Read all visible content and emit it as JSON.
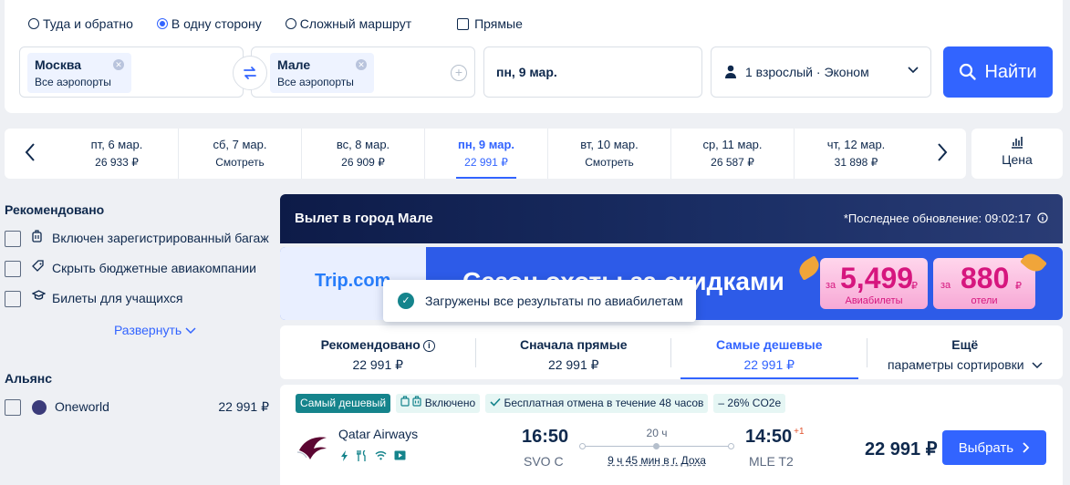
{
  "trip_types": {
    "round_trip": "Туда и обратно",
    "one_way": "В одну сторону",
    "multi_city": "Сложный маршрут",
    "direct": "Прямые"
  },
  "search": {
    "origin_city": "Москва",
    "origin_sub": "Все аэропорты",
    "dest_city": "Мале",
    "dest_sub": "Все аэропорты",
    "date": "пн, 9 мар.",
    "passengers": "1 взрослый · Эконом",
    "button": "Найти"
  },
  "date_bar": {
    "cells": [
      {
        "date": "пт, 6 мар.",
        "price": "26 933 ₽"
      },
      {
        "date": "сб, 7 мар.",
        "price": "Смотреть"
      },
      {
        "date": "вс, 8 мар.",
        "price": "26 909 ₽"
      },
      {
        "date": "пн, 9 мар.",
        "price": "22 991 ₽"
      },
      {
        "date": "вт, 10 мар.",
        "price": "Смотреть"
      },
      {
        "date": "ср, 11 мар.",
        "price": "26 587 ₽"
      },
      {
        "date": "чт, 12 мар.",
        "price": "31 898 ₽"
      }
    ],
    "price_label": "Цена"
  },
  "filters": {
    "recommended_title": "Рекомендовано",
    "items": [
      "Включен зарегистрированный багаж",
      "Скрыть бюджетные авиакомпании",
      "Билеты для учащихся"
    ],
    "expand": "Развернуть",
    "alliance_title": "Альянс",
    "alliance_name": "Oneworld",
    "alliance_price": "22 991 ₽"
  },
  "banner": {
    "title": "Вылет в город Мале",
    "updated": "*Последнее обновление: 09:02:17"
  },
  "ad": {
    "logo": "Trip.com",
    "title": "Сезон охоты за скидками",
    "flights_prefix": "за",
    "flights_price": "5,499",
    "flights_currency": "₽",
    "flights_caption": "Авиабилеты",
    "hotels_prefix": "за",
    "hotels_price": "880",
    "hotels_currency": "₽",
    "hotels_caption": "отели"
  },
  "toast": {
    "text": "Загружены все результаты по авиабилетам"
  },
  "sort": [
    {
      "label": "Рекомендовано",
      "value": "22 991 ₽"
    },
    {
      "label": "Сначала прямые",
      "value": "22 991 ₽"
    },
    {
      "label": "Самые дешевые",
      "value": "22 991 ₽"
    },
    {
      "label": "Ещё",
      "value": "параметры сортировки"
    }
  ],
  "flight": {
    "tag_cheapest": "Самый дешевый",
    "tag_included": "Включено",
    "tag_cancel": "Бесплатная отмена в течение 48 часов",
    "tag_co2": "– 26% CO2e",
    "airline": "Qatar Airways",
    "dep_time": "16:50",
    "dep_airport": "SVO C",
    "duration": "20 ч",
    "stopover": "9 ч 45 мин в г. Доха",
    "arr_time": "14:50",
    "arr_days": "+1",
    "arr_airport": "MLE T2",
    "price": "22 991 ₽",
    "select": "Выбрать"
  },
  "colors": {
    "accent": "#3264ff",
    "teal": "#15848c",
    "promo_pink": "#d6167e"
  }
}
